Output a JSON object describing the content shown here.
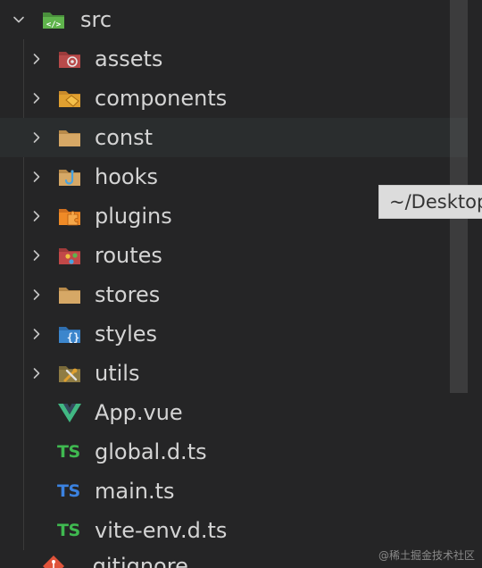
{
  "colors": {
    "background": "#252526",
    "hover_row": "#2a2d2e",
    "text": "#d4d4d4",
    "chevron": "#c5c5c5",
    "ts_green": "#3fb950",
    "ts_blue": "#3b82e0",
    "vue_green": "#41b883",
    "vue_dark": "#34495e"
  },
  "root": {
    "label": "src",
    "icon": "folder-src-open-icon",
    "expanded": true
  },
  "folders": [
    {
      "label": "assets",
      "icon": "folder-assets-icon"
    },
    {
      "label": "components",
      "icon": "folder-components-icon"
    },
    {
      "label": "const",
      "icon": "folder-icon"
    },
    {
      "label": "hooks",
      "icon": "folder-hooks-icon"
    },
    {
      "label": "plugins",
      "icon": "folder-plugins-icon"
    },
    {
      "label": "routes",
      "icon": "folder-routes-icon"
    },
    {
      "label": "stores",
      "icon": "folder-icon"
    },
    {
      "label": "styles",
      "icon": "folder-styles-icon"
    },
    {
      "label": "utils",
      "icon": "folder-utils-icon"
    }
  ],
  "files": [
    {
      "label": "App.vue",
      "icon": "vue-icon"
    },
    {
      "label": "global.d.ts",
      "icon": "ts-definition-icon",
      "badge": "TS"
    },
    {
      "label": "main.ts",
      "icon": "typescript-icon",
      "badge": "TS"
    },
    {
      "label": "vite-env.d.ts",
      "icon": "ts-definition-icon",
      "badge": "TS"
    }
  ],
  "partial_next": {
    "label": ".gitignore",
    "icon": "git-icon"
  },
  "tooltip": {
    "text": "~/Desktop"
  },
  "watermark": {
    "text": "@稀土掘金技术社区"
  }
}
